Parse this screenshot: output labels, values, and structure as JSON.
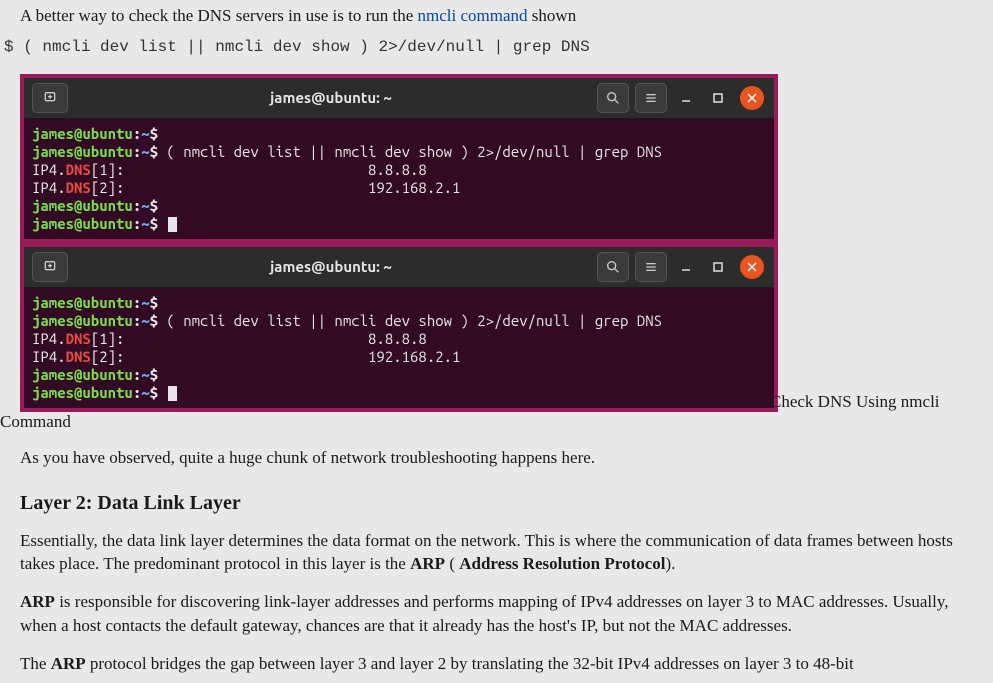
{
  "intro": {
    "text1": "A better way to check the DNS servers in use is to run the ",
    "link_text": "nmcli command",
    "text2": " shown"
  },
  "shell_command": "$ ( nmcli dev list || nmcli dev show ) 2>/dev/null | grep DNS",
  "terminal": {
    "title": "james@ubuntu: ~",
    "prompt_user": "james@ubuntu",
    "prompt_colon": ":",
    "prompt_path": "~",
    "prompt_dollar": "$",
    "cmd": " ( nmcli dev list || nmcli dev show ) 2>/dev/null | grep DNS",
    "out1_prefix": "IP4.",
    "out1_dns": "DNS",
    "out1_idx": "[1]:",
    "out1_val": "                             8.8.8.8",
    "out2_prefix": "IP4.",
    "out2_dns": "DNS",
    "out2_idx": "[2]:",
    "out2_val": "                             192.168.2.1"
  },
  "caption": "Check DNS Using nmcli Command",
  "observed_para": "As you have observed, quite a huge chunk of network troubleshooting happens here.",
  "layer2_heading": "Layer 2: Data Link Layer",
  "layer2_para1_a": "Essentially, the data link layer determines the data format on the network. This is where the communication of data frames between hosts takes place. The predominant protocol in this layer is the ",
  "layer2_para1_arp": "ARP",
  "layer2_para1_b": " ( ",
  "layer2_para1_bold2": "Address Resolution Protocol",
  "layer2_para1_c": ").",
  "layer2_para2_a": "ARP",
  "layer2_para2_b": " is responsible for discovering link-layer addresses and performs mapping of IPv4 addresses on layer 3 to MAC addresses. Usually, when a host contacts the default gateway, chances are that it already has the host's IP, but not the MAC addresses.",
  "layer2_para3_a": "The ",
  "layer2_para3_arp": "ARP",
  "layer2_para3_b": " protocol bridges the gap between layer 3 and layer 2 by translating the 32-bit IPv4 addresses on layer 3 to 48-bit"
}
